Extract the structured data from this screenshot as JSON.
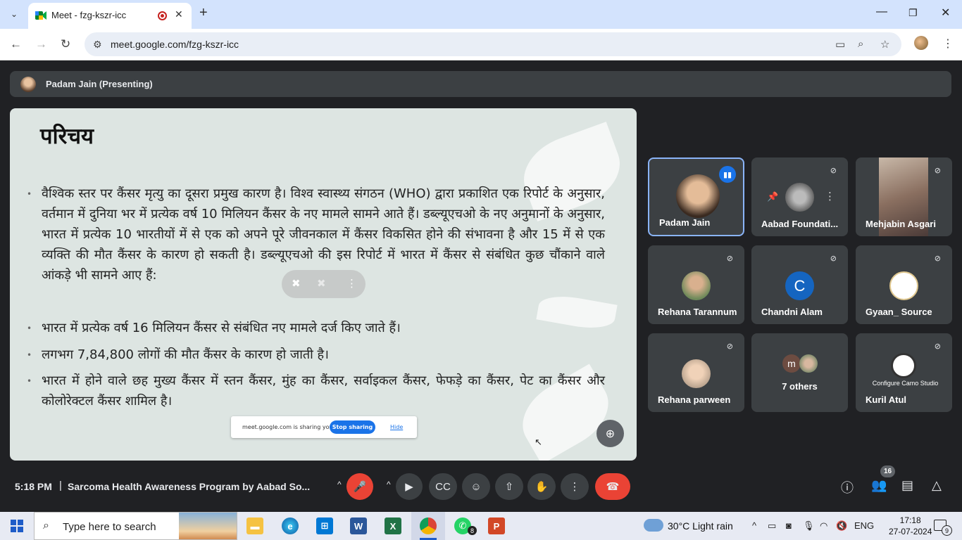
{
  "browser": {
    "tab_title": "Meet - fzg-kszr-icc",
    "url": "meet.google.com/fzg-kszr-icc"
  },
  "presenter": {
    "label": "Padam Jain (Presenting)"
  },
  "slide": {
    "title": "परिचय",
    "bullet1": "वैश्विक स्तर पर कैंसर मृत्यु का दूसरा प्रमुख कारण है। विश्व स्वास्थ्य संगठन (WHO) द्वारा प्रकाशित एक रिपोर्ट के अनुसार, वर्तमान में दुनिया भर में प्रत्येक वर्ष 10 मिलियन कैंसर के नए मामले सामने आते हैं। डब्ल्यूएचओ के नए अनुमानों के अनुसार, भारत में प्रत्येक 10 भारतीयों में से एक को अपने पूरे जीवनकाल में कैंसर विकसित होने की संभावना है और 15 में से एक व्यक्ति की मौत कैंसर के कारण हो सकती है। डब्ल्यूएचओ की इस रिपोर्ट में भारत में कैंसर से संबंधित कुछ चौंकाने वाले आंकड़े भी सामने आए हैं:",
    "bullet2": "भारत में प्रत्येक वर्ष 16 मिलियन कैंसर से संबंधित नए मामले दर्ज किए जाते हैं।",
    "bullet3": "लगभग 7,84,800 लोगों की मौत कैंसर के कारण हो जाती है।",
    "bullet4": "भारत में होने वाले छह मुख्य कैंसर में स्तन कैंसर, मुंह का कैंसर, सर्वाइकल कैंसर, फेफड़े का कैंसर, पेट का कैंसर और कोलोरेक्टल कैंसर शामिल है।"
  },
  "sharing_banner": {
    "text": "meet.google.com is sharing your screen.",
    "stop": "Stop sharing",
    "hide": "Hide"
  },
  "participants": [
    {
      "name": "Padam Jain",
      "color": "#c89b7b"
    },
    {
      "name": "Aabad Foundati...",
      "color": "#8a8f94"
    },
    {
      "name": "Mehjabin Asgari",
      "color": "#b08a78"
    },
    {
      "name": "Rehana Tarannum",
      "color": "#a87e62"
    },
    {
      "name": "Chandni Alam",
      "initial": "C",
      "color": "#1565c0"
    },
    {
      "name": "Gyaan_ Source",
      "color": "#ffffff"
    },
    {
      "name": "Rehana parween",
      "color": "#d8b79a"
    },
    {
      "name": "7 others",
      "initial": "m",
      "color": "#6d4c41"
    },
    {
      "name": "Kuril Atul",
      "color": "#ffffff"
    }
  ],
  "overlay_logo_text": "Configure Camo Studio",
  "bottom": {
    "time": "5:18 PM",
    "separator": "|",
    "meeting_title": "Sarcoma Health Awareness Program by Aabad So...",
    "people_count": "16"
  },
  "taskbar": {
    "search_placeholder": "Type here to search",
    "whatsapp_badge": "8",
    "weather": "30°C  Light rain",
    "lang": "ENG",
    "time": "17:18",
    "date": "27-07-2024",
    "notifications": "9"
  }
}
